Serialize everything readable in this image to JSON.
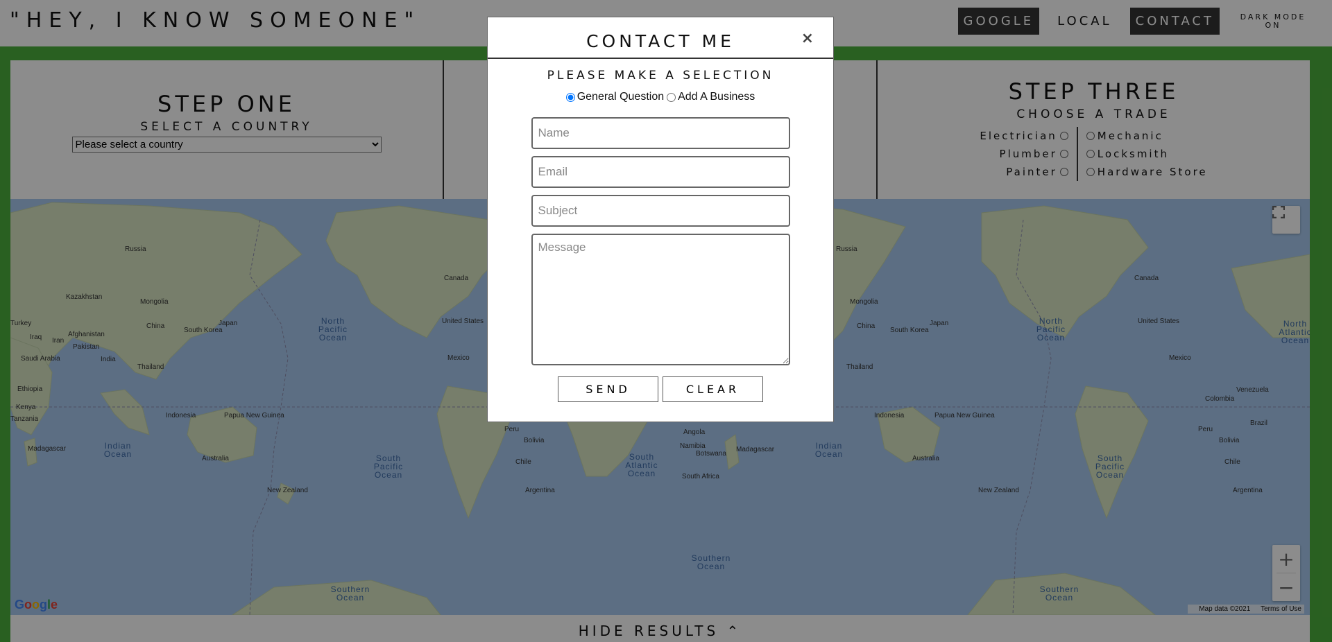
{
  "header": {
    "title": "\"HEY, I KNOW SOMEONE\"",
    "nav": {
      "google": "GOOGLE",
      "local": "LOCAL",
      "contact": "CONTACT",
      "dark_mode_line1": "DARK MODE",
      "dark_mode_line2": "ON"
    }
  },
  "steps": {
    "one": {
      "title": "STEP ONE",
      "subtitle": "SELECT A COUNTRY",
      "select_value": "Please select a country"
    },
    "three": {
      "title": "STEP THREE",
      "subtitle": "CHOOSE A TRADE",
      "trades_left": [
        "Electrician",
        "Plumber",
        "Painter"
      ],
      "trades_right": [
        "Mechanic",
        "Locksmith",
        "Hardware Store"
      ]
    }
  },
  "map": {
    "countries": [
      "Russia",
      "Kazakhstan",
      "Mongolia",
      "China",
      "South Korea",
      "Japan",
      "Turkey",
      "Iraq",
      "Iran",
      "Afghanistan",
      "Pakistan",
      "Saudi Arabia",
      "India",
      "Thailand",
      "Ethiopia",
      "Kenya",
      "Tanzania",
      "Madagascar",
      "Indonesia",
      "Papua New Guinea",
      "Australia",
      "New Zealand",
      "Canada",
      "United States",
      "Mexico",
      "Peru",
      "Bolivia",
      "Chile",
      "Argentina",
      "Angola",
      "Namibia",
      "Botswana",
      "South Africa",
      "Venezuela",
      "Colombia",
      "Brazil"
    ],
    "oceans": {
      "north_pacific": "North Pacific Ocean",
      "south_pacific": "South Pacific Ocean",
      "indian": "Indian Ocean",
      "south_atlantic": "South Atlantic Ocean",
      "north_atlantic": "North Atlantic Ocean",
      "southern": "Southern Ocean"
    },
    "google_logo": "Google",
    "map_data": "Map data ©2021",
    "terms": "Terms of Use",
    "zoom_in": "+",
    "zoom_out": "−"
  },
  "bottom": {
    "hide_results": "HIDE RESULTS ⌃"
  },
  "modal": {
    "title": "CONTACT ME",
    "close": "×",
    "subtitle": "PLEASE MAKE A SELECTION",
    "option_general": "General Question",
    "option_business": "Add A Business",
    "selected_option": "General Question",
    "name_placeholder": "Name",
    "email_placeholder": "Email",
    "subject_placeholder": "Subject",
    "message_placeholder": "Message",
    "send_label": "SEND",
    "clear_label": "CLEAR"
  },
  "colors": {
    "frame_green": "#4caf3c",
    "nav_active": "#333333",
    "ocean": "#a8c9ee",
    "land": "#d9e6c4",
    "radio_blue": "#1a73e8"
  }
}
